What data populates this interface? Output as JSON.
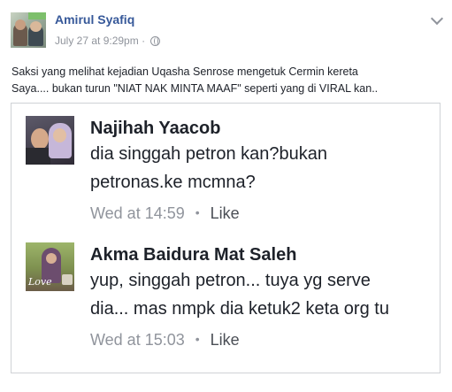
{
  "post": {
    "author": "Amirul Syafiq",
    "timestamp": "July 27 at 9:29pm",
    "separator": "·",
    "privacy_icon": "globe-icon",
    "menu_icon": "chevron-down-icon",
    "text_line1": "Saksi yang melihat kejadian Uqasha Senrose mengetuk Cermin kereta",
    "text_line2": "Saya.... bukan turun \"NIAT NAK MINTA MAAF\" seperti yang di VIRAL kan.."
  },
  "comments": [
    {
      "name": "Najihah Yaacob",
      "line1": "dia singgah petron kan?bukan",
      "line2": "petronas.ke mcmna?",
      "time": "Wed at 14:59",
      "dot": "•",
      "like": "Like"
    },
    {
      "name": "Akma Baidura Mat Saleh",
      "line1": "yup, singgah petron... tuya yg serve",
      "line2": "dia... mas nmpk dia ketuk2 keta org tu",
      "time": "Wed at 15:03",
      "dot": "•",
      "like": "Like",
      "avatar_text": "Love"
    }
  ],
  "colors": {
    "author_link": "#365899",
    "meta_gray": "#90949c",
    "text": "#1d2129",
    "border": "#cfd2d6"
  }
}
